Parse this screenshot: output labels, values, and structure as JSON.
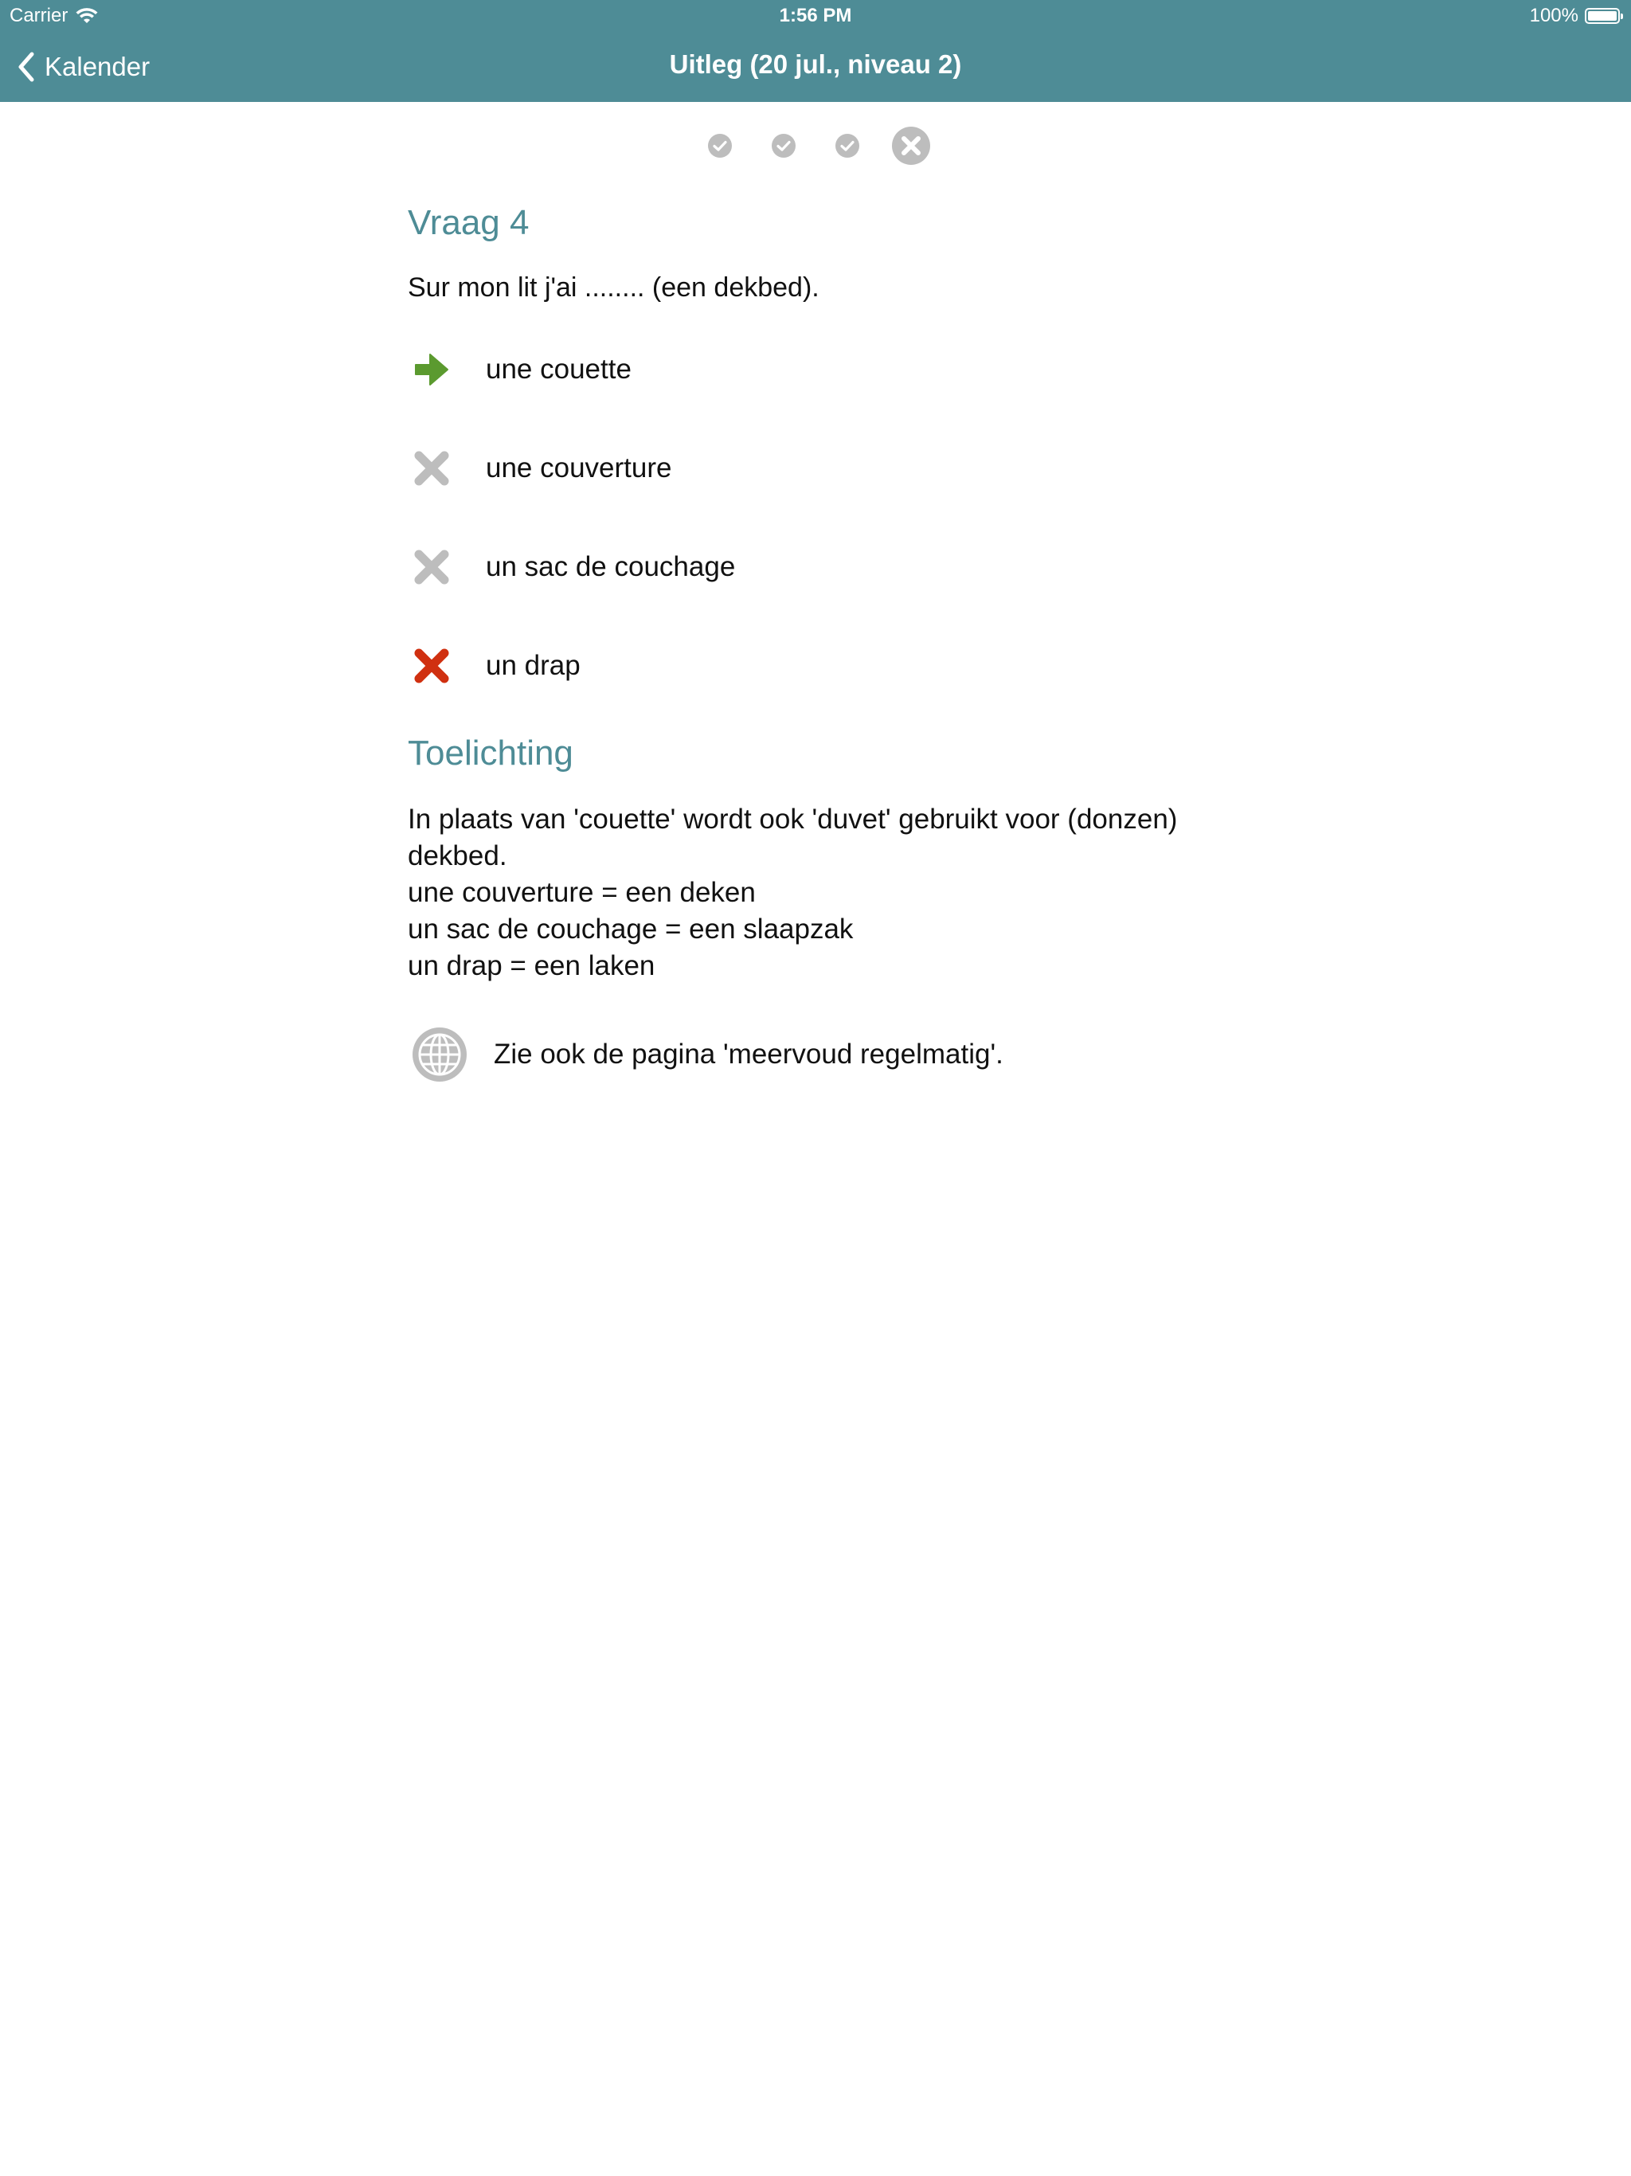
{
  "status_bar": {
    "carrier": "Carrier",
    "time": "1:56 PM",
    "battery": "100%"
  },
  "nav": {
    "back_label": "Kalender",
    "title": "Uitleg (20 jul., niveau 2)"
  },
  "progress": {
    "questions": [
      {
        "state": "correct",
        "icon": "check-circle-icon"
      },
      {
        "state": "correct",
        "icon": "check-circle-icon"
      },
      {
        "state": "correct",
        "icon": "check-circle-icon"
      },
      {
        "state": "wrong-current",
        "icon": "x-circle-icon"
      }
    ]
  },
  "question": {
    "heading": "Vraag 4",
    "text": "Sur mon lit j'ai ........ (een dekbed).",
    "answers": [
      {
        "label": "une couette",
        "status": "correct",
        "icon": "green-arrow-right-icon"
      },
      {
        "label": "une couverture",
        "status": "wrong",
        "icon": "grey-x-icon"
      },
      {
        "label": "un sac de couchage",
        "status": "wrong",
        "icon": "grey-x-icon"
      },
      {
        "label": "un drap",
        "status": "chosen-wrong",
        "icon": "red-x-icon"
      }
    ]
  },
  "explanation": {
    "heading": "Toelichting",
    "lines": [
      "In plaats van 'couette' wordt ook 'duvet' gebruikt voor (donzen)",
      "dekbed.",
      "une couverture = een deken",
      "un sac de couchage = een slaapzak",
      "un drap = een laken"
    ],
    "link_text": "Zie ook de pagina 'meervoud regelmatig'.",
    "link_icon": "globe-icon"
  },
  "colors": {
    "accent": "#4e8c96",
    "correct": "#5b9a2f",
    "wrong": "#bdbdbd",
    "chosen_wrong": "#d03010"
  }
}
